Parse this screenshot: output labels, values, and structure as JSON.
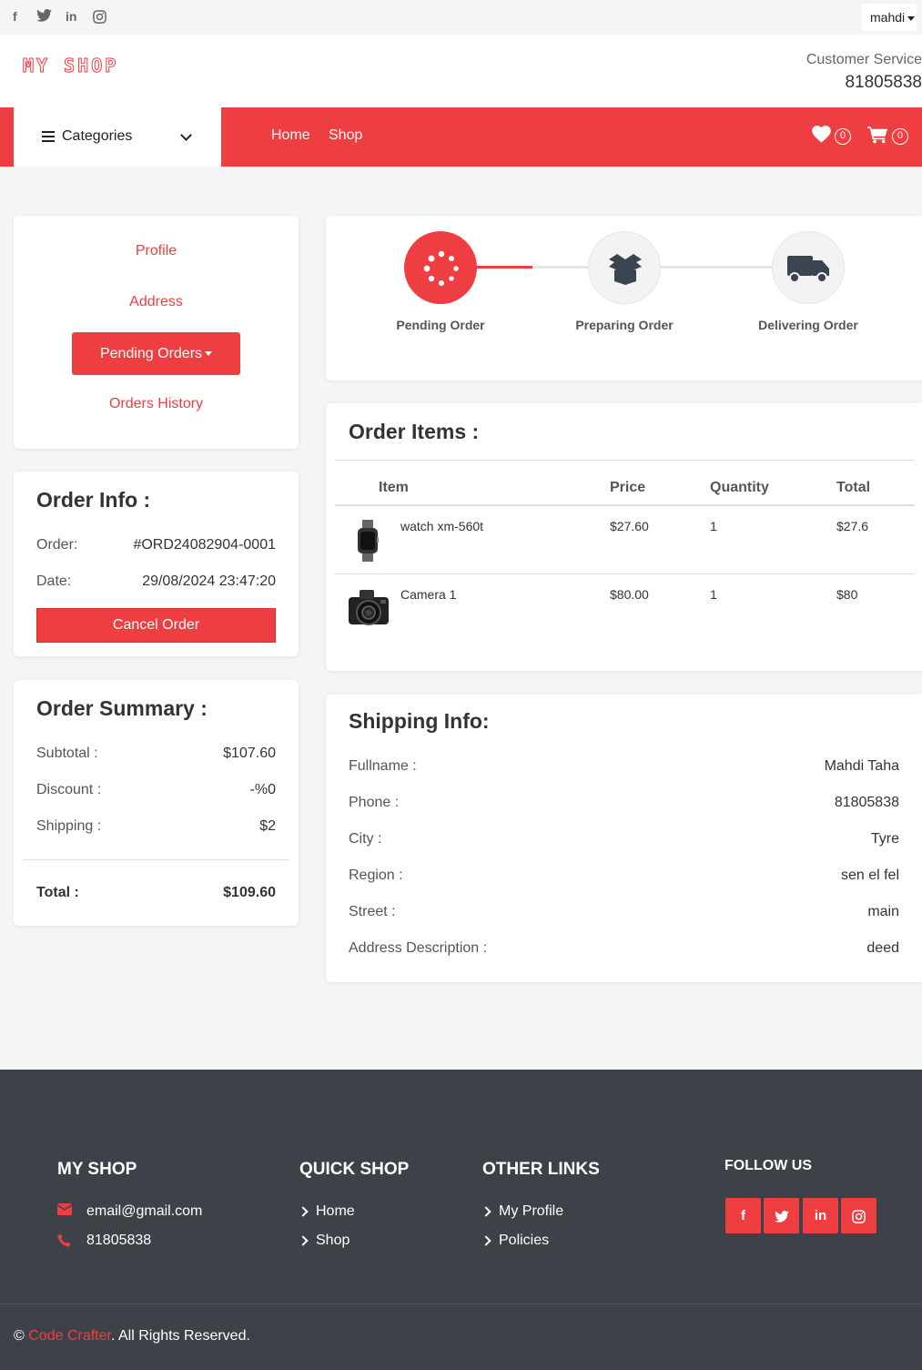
{
  "topbar": {
    "social": [
      "facebook-icon",
      "twitter-icon",
      "linkedin-icon",
      "instagram-icon"
    ],
    "user": "mahdi"
  },
  "header": {
    "logo": "MY SHOP",
    "customer_service_label": "Customer Service",
    "customer_service_phone": "81805838"
  },
  "nav": {
    "categories_label": "Categories",
    "links": [
      "Home",
      "Shop"
    ],
    "wishlist_count": "0",
    "cart_count": "0"
  },
  "account_menu": {
    "profile": "Profile",
    "address": "Address",
    "pending_orders": "Pending Orders",
    "orders_history": "Orders History"
  },
  "order_info": {
    "title": "Order Info :",
    "order_label": "Order:",
    "order_value": "#ORD24082904-0001",
    "date_label": "Date:",
    "date_value": "29/08/2024 23:47:20",
    "cancel_label": "Cancel Order"
  },
  "order_summary": {
    "title": "Order Summary :",
    "subtotal_label": "Subtotal :",
    "subtotal_value": "$107.60",
    "discount_label": "Discount :",
    "discount_value": "-%0",
    "shipping_label": "Shipping :",
    "shipping_value": "$2",
    "total_label": "Total :",
    "total_value": "$109.60"
  },
  "progress": {
    "steps": [
      "Pending Order",
      "Preparing Order",
      "Delivering Order"
    ],
    "active_step": 1
  },
  "order_items": {
    "title": "Order Items :",
    "headers": [
      "Item",
      "Price",
      "Quantity",
      "Total"
    ],
    "rows": [
      {
        "name": "watch xm-560t",
        "price": "$27.60",
        "qty": "1",
        "total": "$27.6",
        "icon": "watch-icon"
      },
      {
        "name": "Camera 1",
        "price": "$80.00",
        "qty": "1",
        "total": "$80",
        "icon": "camera-icon"
      }
    ]
  },
  "shipping_info": {
    "title": "Shipping Info:",
    "fullname_label": "Fullname :",
    "fullname": "Mahdi Taha",
    "phone_label": "Phone :",
    "phone": "81805838",
    "city_label": "City :",
    "city": "Tyre",
    "region_label": "Region :",
    "region": "sen el fel",
    "street_label": "Street :",
    "street": "main",
    "desc_label": "Address Description :",
    "desc": "deed"
  },
  "footer": {
    "shop_head": "MY SHOP",
    "email": "email@gmail.com",
    "phone": "81805838",
    "quick_head": "QUICK SHOP",
    "quick_links": [
      "Home",
      "Shop"
    ],
    "other_head": "OTHER LINKS",
    "other_links": [
      "My Profile",
      "Policies"
    ],
    "follow_head": "FOLLOW US",
    "copyright_brand": "Code Crafter",
    "copyright_rest": ". All Rights Reserved.",
    "copyright_symbol": "©"
  },
  "colors": {
    "accent": "#ef3e42",
    "footer_bg": "#3d4249"
  }
}
